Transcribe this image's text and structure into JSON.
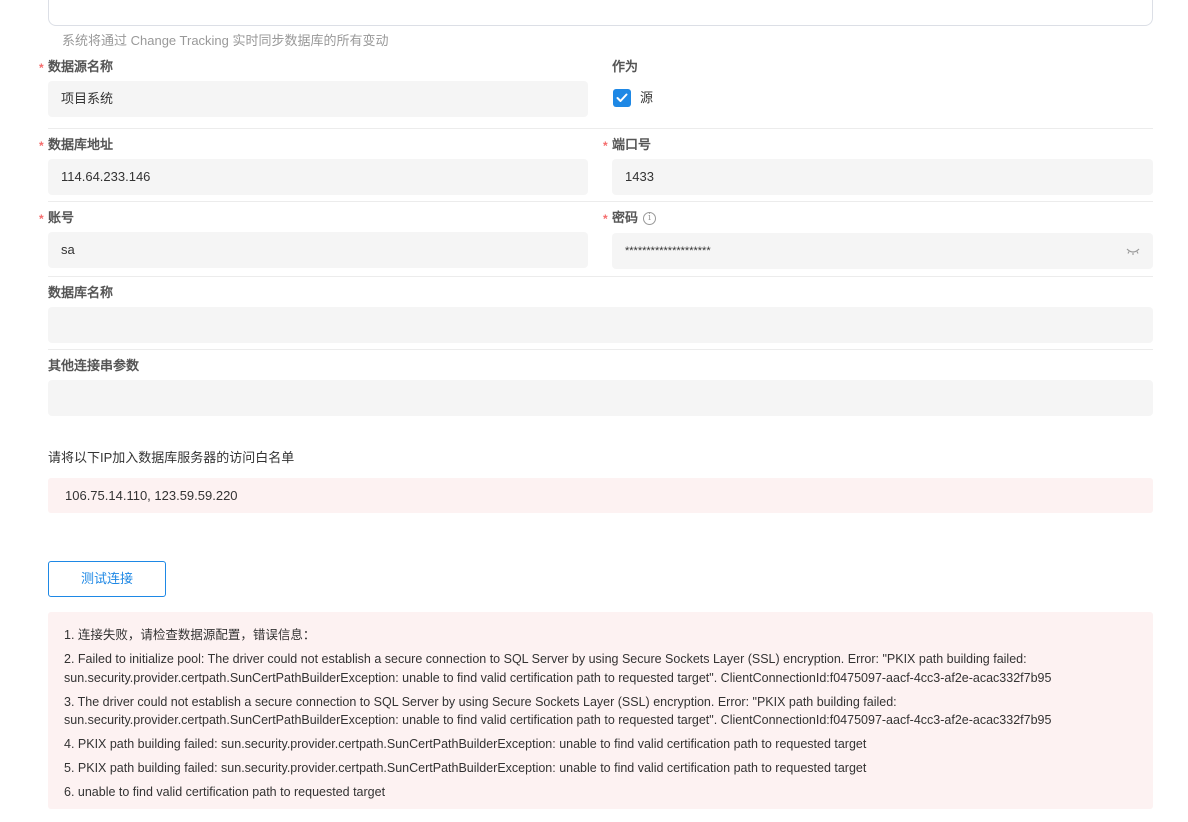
{
  "top_card": {
    "text": "系统将通过 Change Tracking 实时同步数据库的所有变动"
  },
  "form": {
    "datasource_name": {
      "label": "数据源名称",
      "value": "项目系统"
    },
    "role": {
      "label": "作为",
      "checkbox_label": "源",
      "checked": true
    },
    "db_address": {
      "label": "数据库地址",
      "value": "114.64.233.146"
    },
    "port": {
      "label": "端口号",
      "value": "1433"
    },
    "account": {
      "label": "账号",
      "value": "sa"
    },
    "password": {
      "label": "密码",
      "value": "********************",
      "info_icon": "info-icon",
      "toggle_icon": "eye-closed-icon"
    },
    "db_name": {
      "label": "数据库名称",
      "value": ""
    },
    "conn_params": {
      "label": "其他连接串参数",
      "value": ""
    }
  },
  "whitelist": {
    "label": "请将以下IP加入数据库服务器的访问白名单",
    "ips": "106.75.14.110, 123.59.59.220"
  },
  "test_button": {
    "label": "测试连接"
  },
  "errors": [
    "1. 连接失败，请检查数据源配置，错误信息：",
    "2. Failed to initialize pool: The driver could not establish a secure connection to SQL Server by using Secure Sockets Layer (SSL) encryption. Error: \"PKIX path building failed: sun.security.provider.certpath.SunCertPathBuilderException: unable to find valid certification path to requested target\". ClientConnectionId:f0475097-aacf-4cc3-af2e-acac332f7b95",
    "3. The driver could not establish a secure connection to SQL Server by using Secure Sockets Layer (SSL) encryption. Error: \"PKIX path building failed: sun.security.provider.certpath.SunCertPathBuilderException: unable to find valid certification path to requested target\". ClientConnectionId:f0475097-aacf-4cc3-af2e-acac332f7b95",
    "4. PKIX path building failed: sun.security.provider.certpath.SunCertPathBuilderException: unable to find valid certification path to requested target",
    "5. PKIX path building failed: sun.security.provider.certpath.SunCertPathBuilderException: unable to find valid certification path to requested target",
    "6. unable to find valid certification path to requested target"
  ],
  "colors": {
    "accent": "#1e88e5",
    "required": "#f56c6c",
    "error_bg": "#fdf2f2",
    "input_bg": "#f5f5f5"
  }
}
